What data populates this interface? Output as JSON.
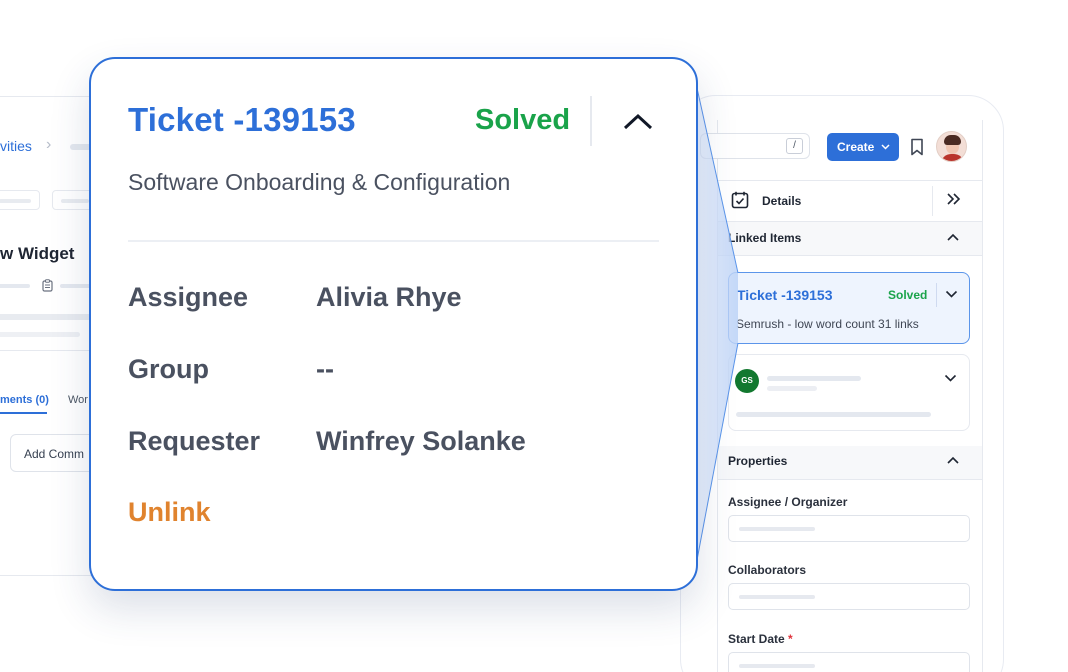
{
  "background_app": {
    "breadcrumb": "vities",
    "widget_title": "w Widget",
    "tabs": {
      "comments": "ments (0)",
      "work": "Wor"
    },
    "add_comment": "Add Comm"
  },
  "topbar": {
    "search_shortcut": "/",
    "create_label": "Create",
    "create_icon": "chevron-down-icon"
  },
  "details": {
    "label": "Details"
  },
  "linked_items": {
    "label": "Linked Items",
    "ticket": {
      "title": "Ticket -139153",
      "status": "Solved",
      "subtitle": "Semrush - low word count 31 links"
    },
    "second_card": {
      "avatar_initials": "GS"
    }
  },
  "properties": {
    "label": "Properties",
    "fields": [
      {
        "label": "Assignee / Organizer",
        "required": false
      },
      {
        "label": "Collaborators",
        "required": false
      },
      {
        "label": "Start Date",
        "required": true,
        "required_mark": "*"
      }
    ]
  },
  "popup": {
    "title": "Ticket -139153",
    "status": "Solved",
    "subtitle": "Software Onboarding & Configuration",
    "rows": [
      {
        "label": "Assignee",
        "value": "Alivia Rhye"
      },
      {
        "label": "Group",
        "value": "--"
      },
      {
        "label": "Requester",
        "value": "Winfrey Solanke"
      }
    ],
    "unlink_label": "Unlink"
  },
  "colors": {
    "accent": "#2d6fd8",
    "solved": "#1aa34a",
    "unlink": "#e0832e",
    "required": "#e0333c",
    "avatar_gs": "#12782f"
  }
}
